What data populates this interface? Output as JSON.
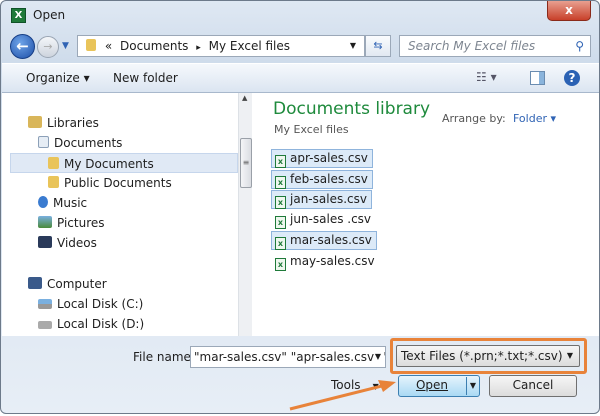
{
  "window": {
    "title": "Open",
    "close_label": "x"
  },
  "address": {
    "path_prefix": "«",
    "crumbs": [
      "Documents",
      "My Excel files"
    ],
    "separator": "▸"
  },
  "search": {
    "placeholder": "Search My Excel files"
  },
  "toolbar": {
    "organize": "Organize ▾",
    "new_folder": "New folder",
    "views": "☷ ▾",
    "help": "?"
  },
  "nav": {
    "items": [
      {
        "label": "Libraries",
        "icon": "libraries-icon"
      },
      {
        "label": "Documents",
        "icon": "documents-icon"
      },
      {
        "label": "My Documents",
        "icon": "folder-icon",
        "selected": true
      },
      {
        "label": "Public Documents",
        "icon": "folder-icon"
      },
      {
        "label": "Music",
        "icon": "music-icon"
      },
      {
        "label": "Pictures",
        "icon": "pictures-icon"
      },
      {
        "label": "Videos",
        "icon": "videos-icon"
      },
      {
        "label": "Computer",
        "icon": "computer-icon"
      },
      {
        "label": "Local Disk (C:)",
        "icon": "drive-icon"
      },
      {
        "label": "Local Disk (D:)",
        "icon": "drive-icon"
      }
    ]
  },
  "library": {
    "title": "Documents library",
    "subtitle": "My Excel files",
    "arrange_label": "Arrange by:",
    "arrange_value": "Folder ▾"
  },
  "files": [
    {
      "name": "apr-sales.csv",
      "selected": true
    },
    {
      "name": "feb-sales.csv",
      "selected": true
    },
    {
      "name": "jan-sales.csv",
      "selected": true
    },
    {
      "name": "jun-sales .csv",
      "selected": false
    },
    {
      "name": "mar-sales.csv",
      "selected": true
    },
    {
      "name": "may-sales.csv",
      "selected": false
    }
  ],
  "bottom": {
    "file_name_label": "File name:",
    "file_name_value": "\"mar-sales.csv\" \"apr-sales.csv\" \"fe",
    "filter_value": "Text Files (*.prn;*.txt;*.csv)",
    "tools": "Tools",
    "open": "Open",
    "cancel": "Cancel"
  },
  "colors": {
    "accent_green": "#1e8a3c",
    "highlight_orange": "#e8833a"
  }
}
